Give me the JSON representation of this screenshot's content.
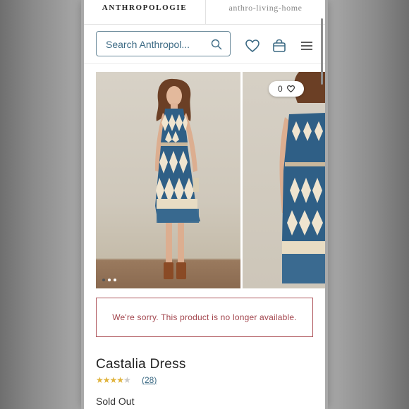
{
  "brand": {
    "primary": "ANTHROPOLOGIE",
    "secondary": "anthro-living-home"
  },
  "search": {
    "placeholder": "Search Anthropol..."
  },
  "gallery": {
    "like_count": "0",
    "dot_count": 3,
    "active_dot": 0
  },
  "alert": {
    "message": "We're sorry. This product is no longer available."
  },
  "product": {
    "name": "Castalia Dress",
    "rating": 4,
    "rating_max": 5,
    "review_count": "(28)",
    "status": "Sold Out"
  },
  "colors": {
    "accent": "#3c6a84",
    "alert": "#a2454d",
    "star": "#e0b33c"
  }
}
